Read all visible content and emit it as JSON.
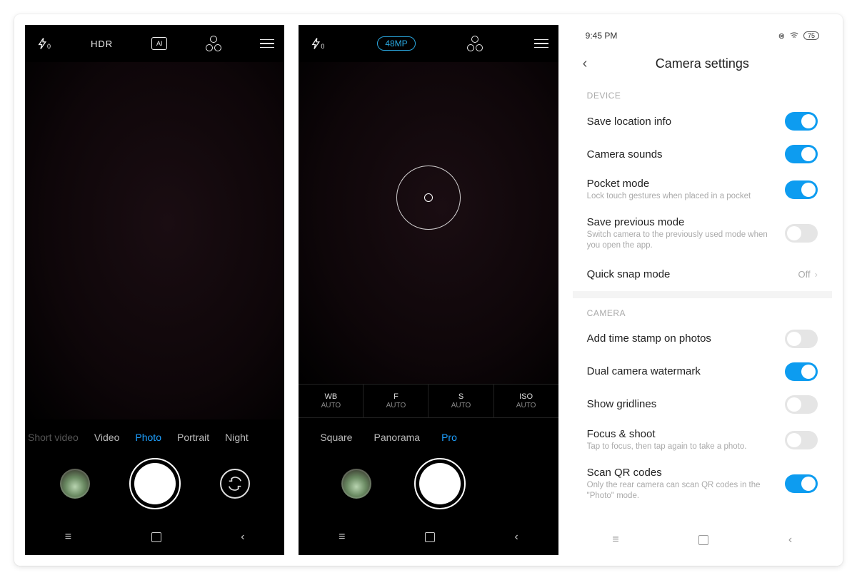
{
  "screen1": {
    "top": {
      "flash": "⚡",
      "flash_sub": "0",
      "hdr": "HDR"
    },
    "modes": [
      "Short video",
      "Video",
      "Photo",
      "Portrait",
      "Night"
    ],
    "active_mode_index": 2
  },
  "screen2": {
    "badge": "48MP",
    "pro": [
      {
        "k": "WB",
        "v": "AUTO"
      },
      {
        "k": "F",
        "v": "AUTO"
      },
      {
        "k": "S",
        "v": "AUTO"
      },
      {
        "k": "ISO",
        "v": "AUTO"
      }
    ],
    "modes": [
      "Square",
      "Panorama",
      "Pro"
    ],
    "active_mode_index": 2
  },
  "settings": {
    "time": "9:45 PM",
    "battery": "75",
    "title": "Camera settings",
    "sections": [
      {
        "header": "DEVICE",
        "rows": [
          {
            "title": "Save location info",
            "type": "toggle",
            "on": true
          },
          {
            "title": "Camera sounds",
            "type": "toggle",
            "on": true
          },
          {
            "title": "Pocket mode",
            "sub": "Lock touch gestures when placed in a pocket",
            "type": "toggle",
            "on": true
          },
          {
            "title": "Save previous mode",
            "sub": "Switch camera to the previously used mode when you open the app.",
            "type": "toggle",
            "on": false
          },
          {
            "title": "Quick snap mode",
            "type": "link",
            "value": "Off"
          }
        ]
      },
      {
        "header": "CAMERA",
        "rows": [
          {
            "title": "Add time stamp on photos",
            "type": "toggle",
            "on": false
          },
          {
            "title": "Dual camera watermark",
            "type": "toggle",
            "on": true
          },
          {
            "title": "Show gridlines",
            "type": "toggle",
            "on": false
          },
          {
            "title": "Focus & shoot",
            "sub": "Tap to focus, then tap again to take a photo.",
            "type": "toggle",
            "on": false
          },
          {
            "title": "Scan QR codes",
            "sub": "Only the rear camera can scan QR codes in the \"Photo\" mode.",
            "type": "toggle",
            "on": true
          }
        ]
      }
    ]
  }
}
